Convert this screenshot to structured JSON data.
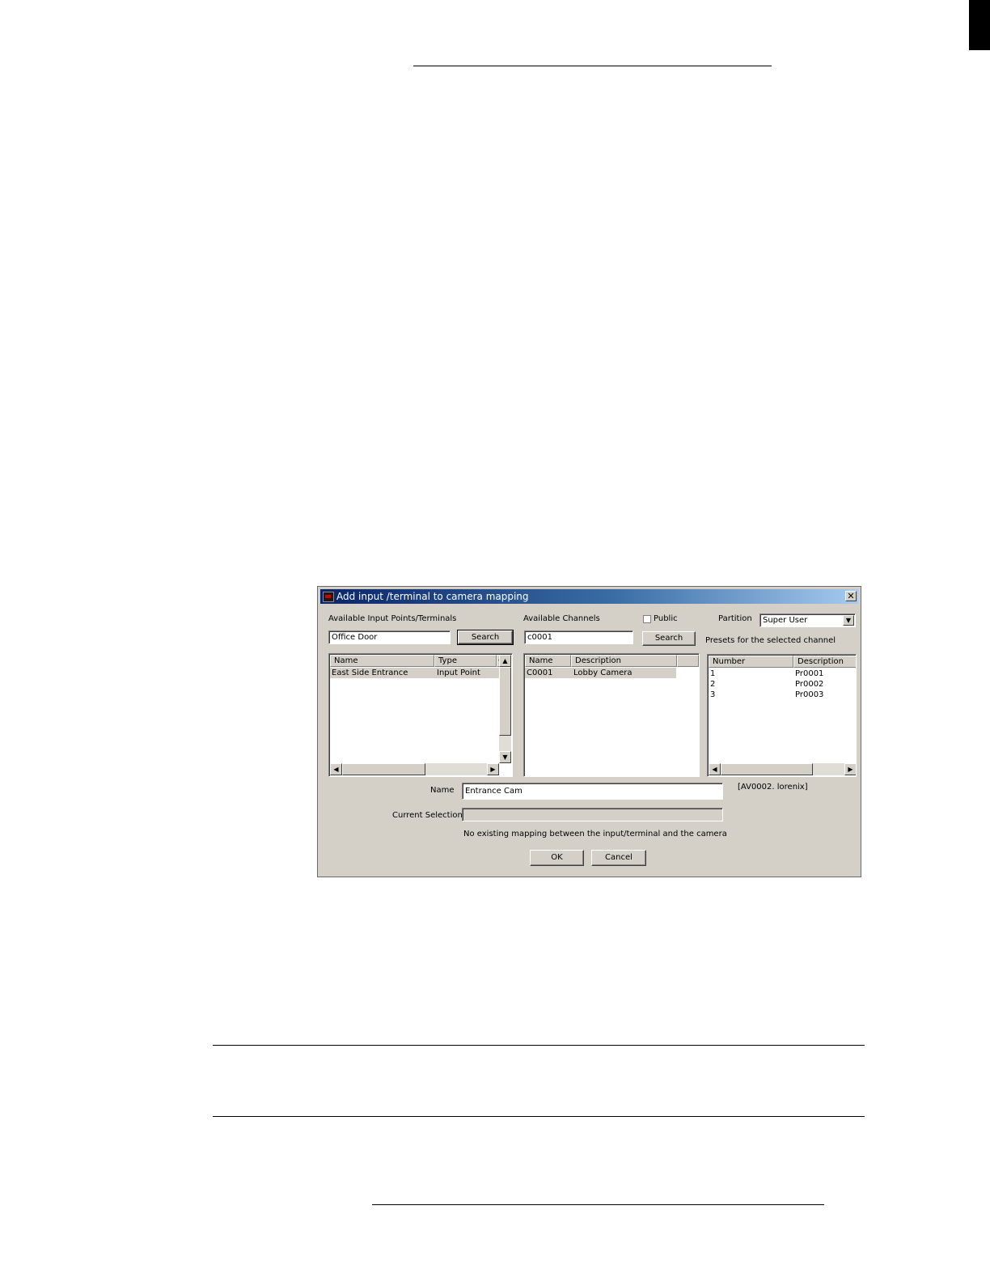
{
  "dialog": {
    "title": "Add input /terminal to camera mapping",
    "close_glyph": "✕",
    "inputs_panel": {
      "label": "Available Input Points/Terminals",
      "search_value": "Office Door",
      "search_button": "Search",
      "columns": [
        "Name",
        "Type",
        "C"
      ],
      "rows": [
        {
          "name": "East Side Entrance",
          "type": "Input Point"
        }
      ]
    },
    "channels_panel": {
      "label": "Available  Channels",
      "search_value": "c0001",
      "search_button": "Search",
      "columns": [
        "Name",
        "Description"
      ],
      "rows": [
        {
          "name": "C0001",
          "description": "Lobby Camera"
        }
      ]
    },
    "public_label": "Public",
    "partition_label": "Partition",
    "partition_value": "Super User",
    "presets_panel": {
      "label": "Presets for the selected channel",
      "columns": [
        "Number",
        "Description"
      ],
      "rows": [
        {
          "number": "1",
          "description": "Pr0001"
        },
        {
          "number": "2",
          "description": "Pr0002"
        },
        {
          "number": "3",
          "description": "Pr0003"
        }
      ]
    },
    "name_label": "Name",
    "name_value": "Entrance Cam",
    "server_note": "[AV0002. lorenix]",
    "current_selection_label": "Current Selection",
    "current_selection_value": "",
    "status_message": "No existing mapping between the input/terminal and the camera",
    "ok_button": "OK",
    "cancel_button": "Cancel"
  },
  "icons": {
    "arrow_up": "▲",
    "arrow_down": "▼",
    "arrow_left": "◀",
    "arrow_right": "▶"
  }
}
